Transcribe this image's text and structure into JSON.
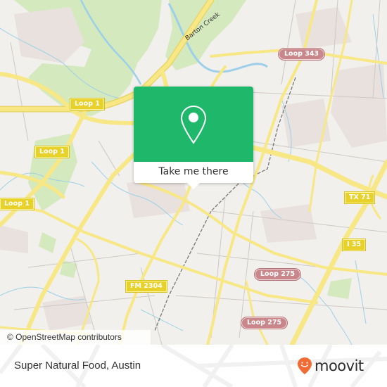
{
  "map": {
    "labels": {
      "loop1_a": "Loop 1",
      "loop1_b": "Loop 1",
      "loop1_c": "Loop 1",
      "loop343": "Loop 343",
      "tx71": "TX 71",
      "i35": "I 35",
      "fm2304": "FM 2304",
      "loop275_a": "Loop 275",
      "loop275_b": "Loop 275",
      "barton_creek": "Barton Creek"
    },
    "colors": {
      "background": "#f2f0ec",
      "park": "#cfe6b3",
      "urban": "#e8e2df",
      "road_major": "#f5e27a",
      "road_minor": "#c8c4c0",
      "water": "#9dd0e8",
      "shield_yellow": "#e8d12a",
      "shield_red": "#c9878c"
    },
    "attribution": "© OpenStreetMap contributors"
  },
  "popup": {
    "action_label": "Take me there",
    "icon": "map-pin-icon",
    "color": "#1fb86a"
  },
  "footer": {
    "place_name": "Super Natural Food, Austin",
    "brand": "moovit",
    "brand_color": "#f26b35"
  }
}
